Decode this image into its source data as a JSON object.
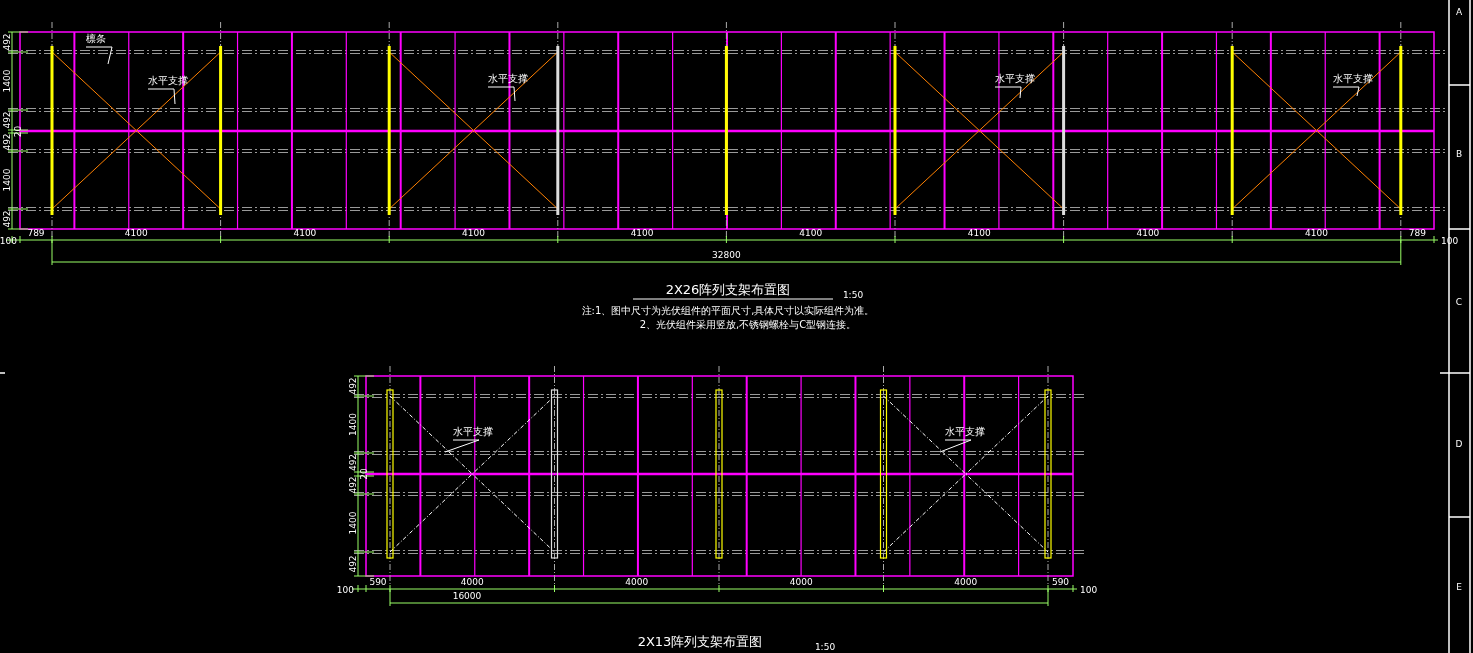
{
  "drawing_1": {
    "title": "2X26阵列支架布置图",
    "scale": "1:50",
    "notes": [
      "注:1、图中尺寸为光伏组件的平面尺寸,具体尺寸以实际组件为准。",
      "2、光伏组件采用竖放,不锈钢螺栓与C型钢连接。"
    ],
    "callouts": [
      "檩条",
      "水平支撑",
      "水平支撑",
      "水平支撑",
      "水平支撑"
    ],
    "row_dims": [
      "492",
      "1400",
      "492",
      "20",
      "492",
      "1400",
      "492"
    ],
    "bay_dims": [
      "100",
      "789",
      "4100",
      "4100",
      "4100",
      "4100",
      "4100",
      "4100",
      "4100",
      "4100",
      "789",
      "100"
    ],
    "total_dim": "32800"
  },
  "drawing_2": {
    "title": "2X13阵列支架布置图",
    "scale": "1:50",
    "callouts": [
      "水平支撑",
      "水平支撑"
    ],
    "row_dims": [
      "492",
      "1400",
      "492",
      "20",
      "492",
      "1400",
      "492"
    ],
    "bay_dims": [
      "100",
      "590",
      "4000",
      "4000",
      "4000",
      "4000",
      "590",
      "100"
    ],
    "total_dim": "16000"
  },
  "border_zones": [
    "A",
    "B",
    "C",
    "D",
    "E"
  ]
}
